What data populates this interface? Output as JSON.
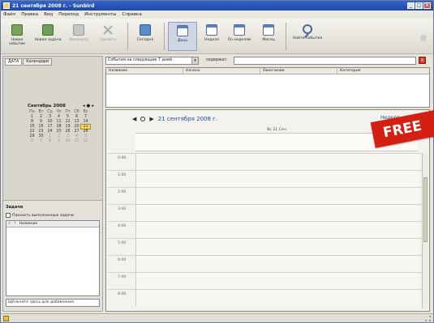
{
  "window": {
    "title": "21 сентября 2008 г. - Sunbird"
  },
  "menu": [
    "Файл",
    "Правка",
    "Вид",
    "Переход",
    "Инструменты",
    "Справка"
  ],
  "toolbar": {
    "new_event": "Новое событие",
    "new_task": "Новая задача",
    "edit": "Изменить",
    "delete": "Удалить",
    "today": "Сегодня",
    "day": "День",
    "week": "Неделя",
    "multiweek": "По неделям",
    "month": "Месяц",
    "find": "Найти события"
  },
  "left_tabs": [
    "ДАТА",
    "Календари"
  ],
  "mini_calendar": {
    "month_label": "Сентябрь",
    "year": "2008",
    "weekdays": [
      "Пн",
      "Вт",
      "Ср",
      "Чт",
      "Пт",
      "Сб",
      "Вс"
    ],
    "weeks": [
      [
        "1",
        "2",
        "3",
        "4",
        "5",
        "6",
        "7"
      ],
      [
        "8",
        "9",
        "10",
        "11",
        "12",
        "13",
        "14"
      ],
      [
        "15",
        "16",
        "17",
        "18",
        "19",
        "20",
        "21"
      ],
      [
        "22",
        "23",
        "24",
        "25",
        "26",
        "27",
        "28"
      ],
      [
        "29",
        "30",
        "1",
        "2",
        "3",
        "4",
        "5"
      ],
      [
        "6",
        "7",
        "8",
        "9",
        "10",
        "11",
        "12"
      ]
    ],
    "selected_day": "21"
  },
  "tasks": {
    "title": "Задачи",
    "show_completed": "Показать выполненные задачи",
    "column_title": "Название",
    "new_task_placeholder": "Щёлкните здесь для добавления"
  },
  "filter": {
    "selected": "События на следующие 7 дней",
    "contains_label": "содержат:"
  },
  "event_list_columns": [
    "Название",
    "Начало",
    "Окончание",
    "Категория"
  ],
  "day_view": {
    "date_title": "21 сентября 2008 г.",
    "week_label": "Неделя",
    "day_header": "Вс 21 Сен",
    "hours": [
      "0:00",
      "1:00",
      "2:00",
      "3:00",
      "4:00",
      "5:00",
      "6:00",
      "7:00",
      "8:00"
    ]
  },
  "badge": "FREE"
}
